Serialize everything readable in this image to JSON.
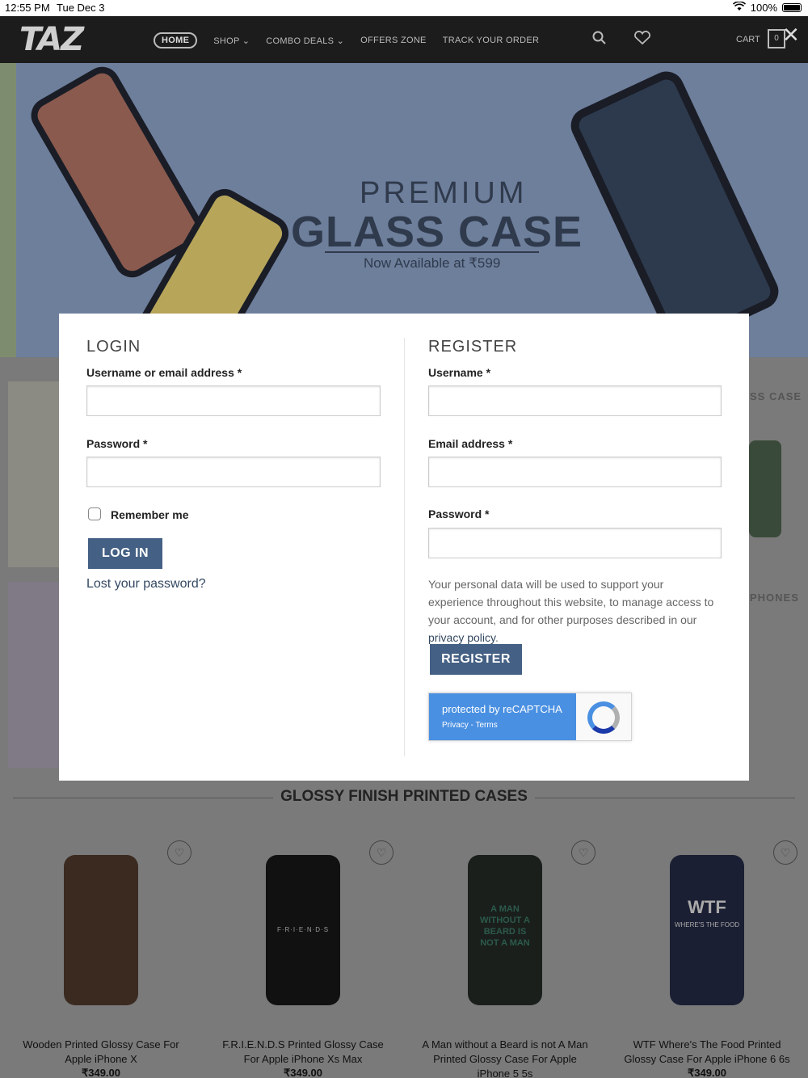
{
  "statusbar": {
    "time": "12:55 PM",
    "date": "Tue Dec 3",
    "battery": "100%"
  },
  "header": {
    "logo": "TAZ",
    "nav": {
      "home": "HOME",
      "shop": "SHOP",
      "combo": "COMBO DEALS",
      "offers": "OFFERS ZONE",
      "track": "TRACK YOUR ORDER"
    },
    "cart_label": "CART",
    "cart_count": "0"
  },
  "hero": {
    "line1": "PREMIUM",
    "line2": "GLASS CASE",
    "sub": "Now Available at ₹599"
  },
  "background": {
    "ghost1": "SS CASE",
    "ghost2": "PHONES",
    "section_title": "GLOSSY FINISH PRINTED CASES",
    "products": [
      {
        "name": "Wooden Printed Glossy Case For Apple iPhone X",
        "price": "₹349.00"
      },
      {
        "name": "F.R.I.E.N.D.S Printed Glossy Case For Apple iPhone Xs Max",
        "price": "₹349.00"
      },
      {
        "name": "A Man without a Beard is not A Man Printed Glossy Case For Apple iPhone 5 5s",
        "price": ""
      },
      {
        "name": "WTF Where's The Food Printed Glossy Case For Apple iPhone 6 6s",
        "price": "₹349.00"
      }
    ],
    "case_texts": {
      "friends": "F·R·I·E·N·D·S",
      "wtf": "WTF",
      "wtf_sub": "WHERE'S THE FOOD",
      "beard": "A MAN WITHOUT A BEARD IS NOT A MAN"
    }
  },
  "login": {
    "title": "LOGIN",
    "username_label": "Username or email address *",
    "password_label": "Password *",
    "remember": "Remember me",
    "button": "LOG IN",
    "lost": "Lost your password?"
  },
  "register": {
    "title": "REGISTER",
    "username_label": "Username *",
    "email_label": "Email address *",
    "password_label": "Password *",
    "privacy_text": "Your personal data will be used to support your experience throughout this website, to manage access to your account, and for other purposes described in our ",
    "privacy_link": "privacy policy",
    "privacy_end": ".",
    "button": "REGISTER"
  },
  "recaptcha": {
    "text": "protected by reCAPTCHA",
    "links": "Privacy - Terms"
  },
  "colors": {
    "header_bg": "#1c1c1c",
    "button": "#446084",
    "link": "#334862"
  }
}
